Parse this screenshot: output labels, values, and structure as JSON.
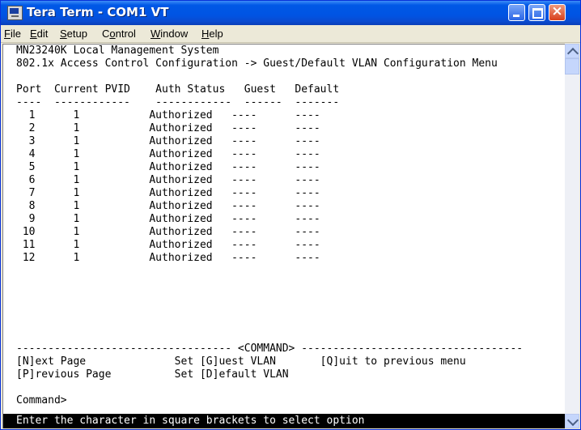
{
  "window": {
    "title": "Tera Term - COM1 VT"
  },
  "menu": [
    {
      "hot": "F",
      "rest": "ile"
    },
    {
      "hot": "E",
      "rest": "dit"
    },
    {
      "hot": "S",
      "rest": "etup"
    },
    {
      "pre": "C",
      "hot": "o",
      "rest": "ntrol"
    },
    {
      "hot": "W",
      "rest": "indow"
    },
    {
      "hot": "H",
      "rest": "elp"
    }
  ],
  "terminal": {
    "header1": "MN23240K Local Management System",
    "header2": "802.1x Access Control Configuration -> Guest/Default VLAN Configuration Menu",
    "columns": [
      "Port",
      "Current PVID",
      "Auth Status",
      "Guest",
      "Default"
    ],
    "underlines": [
      "----",
      "------------",
      "------------",
      "------",
      "-------"
    ],
    "rows": [
      {
        "port": "1",
        "pvid": "1",
        "auth": "Authorized",
        "guest": "----",
        "default": "----"
      },
      {
        "port": "2",
        "pvid": "1",
        "auth": "Authorized",
        "guest": "----",
        "default": "----"
      },
      {
        "port": "3",
        "pvid": "1",
        "auth": "Authorized",
        "guest": "----",
        "default": "----"
      },
      {
        "port": "4",
        "pvid": "1",
        "auth": "Authorized",
        "guest": "----",
        "default": "----"
      },
      {
        "port": "5",
        "pvid": "1",
        "auth": "Authorized",
        "guest": "----",
        "default": "----"
      },
      {
        "port": "6",
        "pvid": "1",
        "auth": "Authorized",
        "guest": "----",
        "default": "----"
      },
      {
        "port": "7",
        "pvid": "1",
        "auth": "Authorized",
        "guest": "----",
        "default": "----"
      },
      {
        "port": "8",
        "pvid": "1",
        "auth": "Authorized",
        "guest": "----",
        "default": "----"
      },
      {
        "port": "9",
        "pvid": "1",
        "auth": "Authorized",
        "guest": "----",
        "default": "----"
      },
      {
        "port": "10",
        "pvid": "1",
        "auth": "Authorized",
        "guest": "----",
        "default": "----"
      },
      {
        "port": "11",
        "pvid": "1",
        "auth": "Authorized",
        "guest": "----",
        "default": "----"
      },
      {
        "port": "12",
        "pvid": "1",
        "auth": "Authorized",
        "guest": "----",
        "default": "----"
      }
    ],
    "command_divider": "---------------------------------- <COMMAND> -----------------------------------",
    "commands": [
      {
        "left": "[N]ext Page",
        "mid": "Set [G]uest VLAN",
        "right": "[Q]uit to previous menu"
      },
      {
        "left": "[P]revious Page",
        "mid": "Set [D]efault VLAN",
        "right": ""
      }
    ],
    "prompt": "Command>",
    "status": "Enter the character in square brackets to select option"
  },
  "colors": {
    "titlebar": "#0054e3",
    "terminal_bg": "#ffffff",
    "status_bg": "#000000"
  }
}
